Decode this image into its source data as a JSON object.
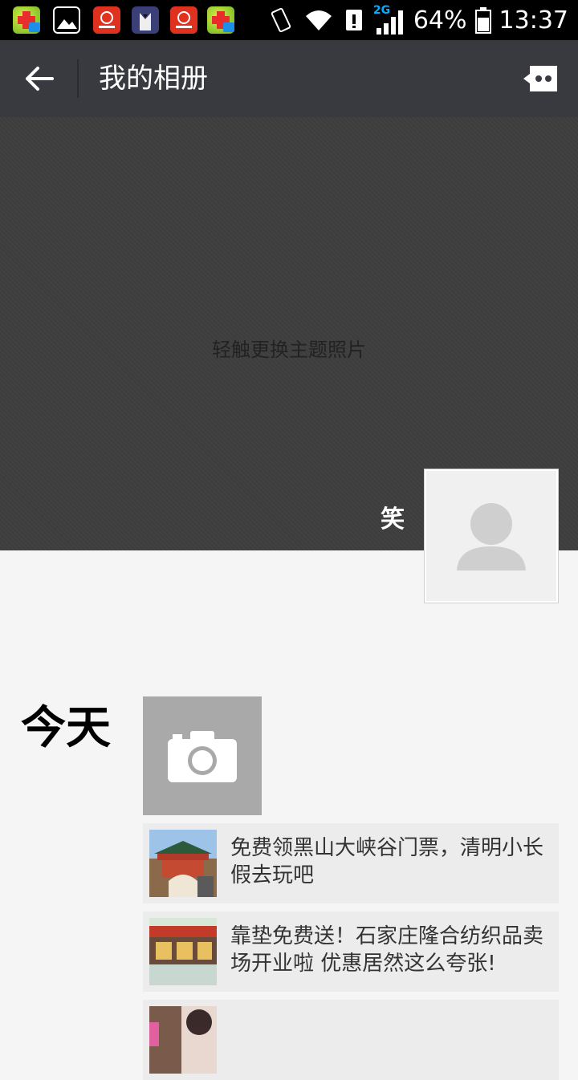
{
  "status_bar": {
    "network": "2G",
    "battery": "64%",
    "time": "13:37"
  },
  "header": {
    "title": "我的相册"
  },
  "cover": {
    "hint": "轻触更换主题照片",
    "user_name": "笑"
  },
  "feed": {
    "day_label": "今天",
    "posts": [
      {
        "text": "免费领黑山大峡谷门票，清明小长假去玩吧"
      },
      {
        "text": "靠垫免费送！石家庄隆合纺织品卖场开业啦 优惠居然这么夸张!"
      },
      {
        "text": ""
      }
    ]
  },
  "colors": {
    "header_bg": "#393a3f",
    "cover_bg": "#3e3e3e",
    "page_bg": "#f5f5f5",
    "post_bg": "#ececec"
  }
}
